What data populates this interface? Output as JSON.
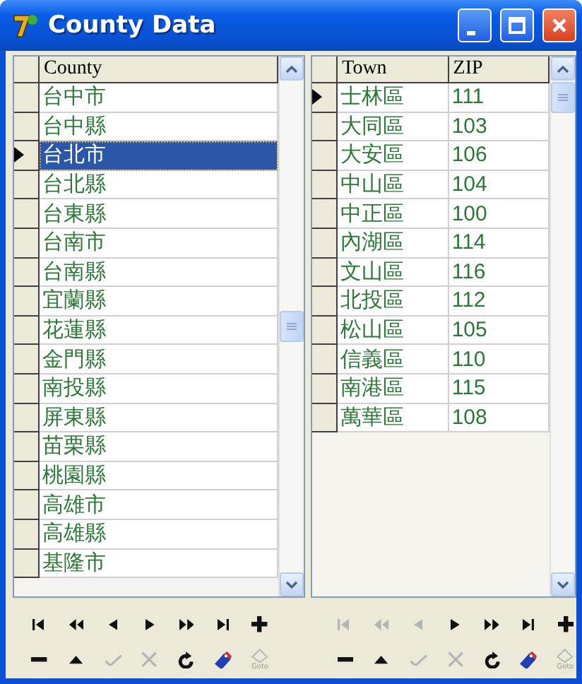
{
  "window": {
    "title": "County Data"
  },
  "county_grid": {
    "columns": [
      "County"
    ],
    "rows": [
      {
        "cells": [
          "台中市"
        ],
        "current": false,
        "selected": false
      },
      {
        "cells": [
          "台中縣"
        ],
        "current": false,
        "selected": false
      },
      {
        "cells": [
          "台北市"
        ],
        "current": true,
        "selected": true
      },
      {
        "cells": [
          "台北縣"
        ],
        "current": false,
        "selected": false
      },
      {
        "cells": [
          "台東縣"
        ],
        "current": false,
        "selected": false
      },
      {
        "cells": [
          "台南市"
        ],
        "current": false,
        "selected": false
      },
      {
        "cells": [
          "台南縣"
        ],
        "current": false,
        "selected": false
      },
      {
        "cells": [
          "宜蘭縣"
        ],
        "current": false,
        "selected": false
      },
      {
        "cells": [
          "花蓮縣"
        ],
        "current": false,
        "selected": false
      },
      {
        "cells": [
          "金門縣"
        ],
        "current": false,
        "selected": false
      },
      {
        "cells": [
          "南投縣"
        ],
        "current": false,
        "selected": false
      },
      {
        "cells": [
          "屏東縣"
        ],
        "current": false,
        "selected": false
      },
      {
        "cells": [
          "苗栗縣"
        ],
        "current": false,
        "selected": false
      },
      {
        "cells": [
          "桃園縣"
        ],
        "current": false,
        "selected": false
      },
      {
        "cells": [
          "高雄市"
        ],
        "current": false,
        "selected": false
      },
      {
        "cells": [
          "高雄縣"
        ],
        "current": false,
        "selected": false
      },
      {
        "cells": [
          "基隆市"
        ],
        "current": false,
        "selected": false
      }
    ]
  },
  "town_grid": {
    "columns": [
      "Town",
      "ZIP"
    ],
    "rows": [
      {
        "cells": [
          "士林區",
          "111"
        ],
        "current": true,
        "selected": false
      },
      {
        "cells": [
          "大同區",
          "103"
        ],
        "current": false,
        "selected": false
      },
      {
        "cells": [
          "大安區",
          "106"
        ],
        "current": false,
        "selected": false
      },
      {
        "cells": [
          "中山區",
          "104"
        ],
        "current": false,
        "selected": false
      },
      {
        "cells": [
          "中正區",
          "100"
        ],
        "current": false,
        "selected": false
      },
      {
        "cells": [
          "內湖區",
          "114"
        ],
        "current": false,
        "selected": false
      },
      {
        "cells": [
          "文山區",
          "116"
        ],
        "current": false,
        "selected": false
      },
      {
        "cells": [
          "北投區",
          "112"
        ],
        "current": false,
        "selected": false
      },
      {
        "cells": [
          "松山區",
          "105"
        ],
        "current": false,
        "selected": false
      },
      {
        "cells": [
          "信義區",
          "110"
        ],
        "current": false,
        "selected": false
      },
      {
        "cells": [
          "南港區",
          "115"
        ],
        "current": false,
        "selected": false
      },
      {
        "cells": [
          "萬華區",
          "108"
        ],
        "current": false,
        "selected": false
      }
    ]
  },
  "county_navigator": {
    "buttons": [
      {
        "kind": "first",
        "disabled": false
      },
      {
        "kind": "prior_page",
        "disabled": false
      },
      {
        "kind": "prior",
        "disabled": false
      },
      {
        "kind": "next",
        "disabled": false
      },
      {
        "kind": "next_page",
        "disabled": false
      },
      {
        "kind": "last",
        "disabled": false
      },
      {
        "kind": "insert",
        "disabled": false
      },
      {
        "kind": "delete",
        "disabled": false
      },
      {
        "kind": "edit",
        "disabled": false
      },
      {
        "kind": "post",
        "disabled": true
      },
      {
        "kind": "cancel",
        "disabled": true
      },
      {
        "kind": "refresh",
        "disabled": false
      },
      {
        "kind": "bookmark",
        "disabled": false
      },
      {
        "kind": "goto",
        "disabled": true,
        "caption": "Goto"
      }
    ]
  },
  "town_navigator": {
    "buttons": [
      {
        "kind": "first",
        "disabled": true
      },
      {
        "kind": "prior_page",
        "disabled": true
      },
      {
        "kind": "prior",
        "disabled": true
      },
      {
        "kind": "next",
        "disabled": false
      },
      {
        "kind": "next_page",
        "disabled": false
      },
      {
        "kind": "last",
        "disabled": false
      },
      {
        "kind": "insert",
        "disabled": false
      },
      {
        "kind": "delete",
        "disabled": false
      },
      {
        "kind": "edit",
        "disabled": false
      },
      {
        "kind": "post",
        "disabled": true
      },
      {
        "kind": "cancel",
        "disabled": true
      },
      {
        "kind": "refresh",
        "disabled": false
      },
      {
        "kind": "bookmark",
        "disabled": false
      },
      {
        "kind": "goto",
        "disabled": true,
        "caption": "Goto"
      }
    ]
  }
}
